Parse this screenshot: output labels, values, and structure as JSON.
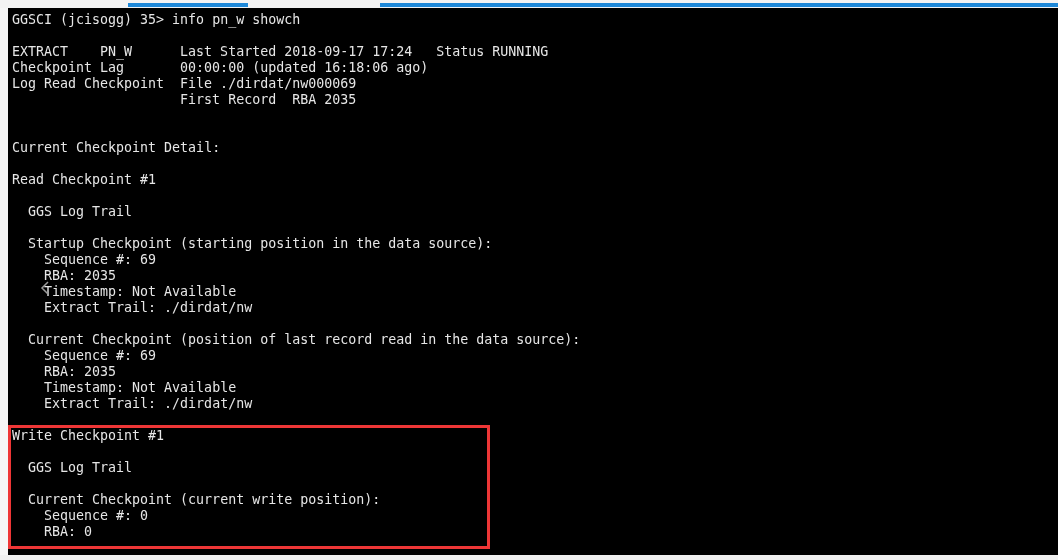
{
  "terminal": {
    "command": "GGSCI (jcisogg) 35> info pn_w showch",
    "summary": [
      {
        "label": "EXTRACT",
        "name": "PN_W",
        "value": "Last Started 2018-09-17 17:24",
        "status": "Status RUNNING"
      },
      {
        "label": "Checkpoint Lag",
        "value": "00:00:00 (updated 16:18:06 ago)"
      },
      {
        "label": "Log Read Checkpoint",
        "value": "File ./dirdat/nw000069"
      },
      {
        "value": "First Record  RBA 2035"
      }
    ],
    "detail_title": "Current Checkpoint Detail:",
    "checkpoints": [
      {
        "title": "Read Checkpoint #1",
        "highlighted": false,
        "trail": "GGS Log Trail",
        "positions": [
          {
            "heading": "Startup Checkpoint (starting position in the data source):",
            "fields": [
              "Sequence #: 69",
              "RBA: 2035",
              "Timestamp: Not Available",
              "Extract Trail: ./dirdat/nw"
            ]
          },
          {
            "heading": "Current Checkpoint (position of last record read in the data source):",
            "fields": [
              "Sequence #: 69",
              "RBA: 2035",
              "Timestamp: Not Available",
              "Extract Trail: ./dirdat/nw"
            ]
          }
        ]
      },
      {
        "title": "Write Checkpoint #1",
        "highlighted": true,
        "trail": "GGS Log Trail",
        "positions": [
          {
            "heading": "Current Checkpoint (current write position):",
            "fields": [
              "Sequence #: 0",
              "RBA: 0"
            ]
          }
        ]
      }
    ]
  }
}
